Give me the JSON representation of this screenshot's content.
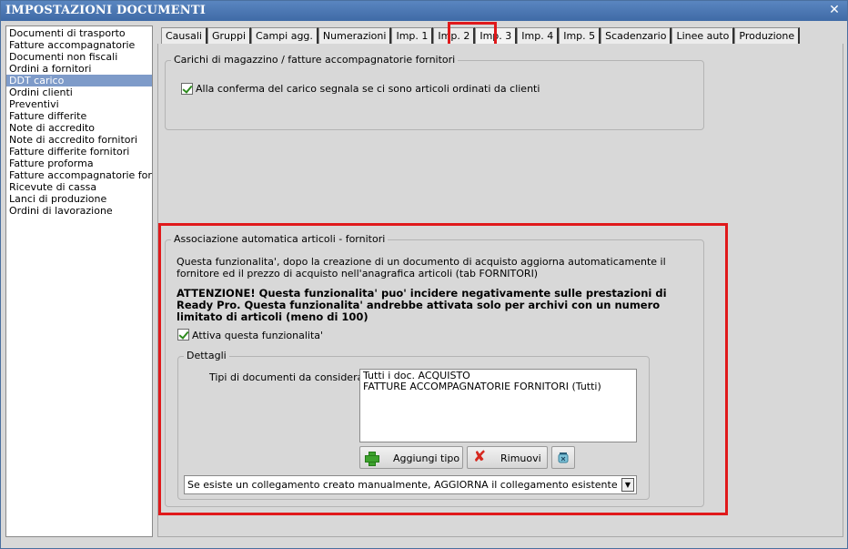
{
  "window": {
    "title": "IMPOSTAZIONI DOCUMENTI",
    "close_glyph": "✕"
  },
  "leftlist": {
    "items": [
      "Documenti di trasporto",
      "Fatture accompagnatorie",
      "Documenti non fiscali",
      "Ordini a fornitori",
      "DDT carico",
      "Ordini clienti",
      "Preventivi",
      "Fatture differite",
      "Note di accredito",
      "Note di accredito fornitori",
      "Fatture differite fornitori",
      "Fatture proforma",
      "Fatture accompagnatorie fornitori",
      "Ricevute di cassa",
      "Lanci di produzione",
      "Ordini di lavorazione"
    ],
    "selected": "DDT carico"
  },
  "tabs": [
    "Causali",
    "Gruppi",
    "Campi agg.",
    "Numerazioni",
    "Imp. 1",
    "Imp. 2",
    "Imp. 3",
    "Imp. 4",
    "Imp. 5",
    "Scadenzario",
    "Linee auto",
    "Produzione"
  ],
  "active_tab": "Imp. 3",
  "group1": {
    "legend": "Carichi di magazzino / fatture accompagnatorie fornitori",
    "checkbox_label": "Alla conferma del carico segnala se ci sono articoli ordinati da clienti",
    "checked": true
  },
  "group2": {
    "legend": "Associazione automatica articoli - fornitori",
    "desc_line1": "Questa funzionalita', dopo la creazione di un documento di acquisto aggiorna automaticamente il",
    "desc_line2": "fornitore ed il prezzo di acquisto nell'anagrafica articoli (tab FORNITORI)",
    "warn_line1": "ATTENZIONE! Questa funzionalita' puo' incidere negativamente sulle prestazioni di",
    "warn_line2": "Ready Pro. Questa funzionalita' andrebbe attivata solo per archivi con un numero",
    "warn_line3": "limitato di articoli (meno di 100)",
    "activate_label": "Attiva questa funzionalita'",
    "activate_checked": true,
    "details": {
      "legend": "Dettagli",
      "doc_types_label": "Tipi di documenti da considerare:",
      "doc_types": [
        "Tutti i doc. ACQUISTO",
        "FATTURE ACCOMPAGNATORIE FORNITORI (Tutti)"
      ],
      "add_button": "Aggiungi tipo",
      "remove_button": "Rimuovi",
      "select_value": "Se esiste un collegamento creato manualmente, AGGIORNA il collegamento esistente"
    }
  },
  "colors": {
    "highlight": "#e0191b",
    "titlebar": "#4a76b0",
    "selected": "#7e9bc9"
  }
}
